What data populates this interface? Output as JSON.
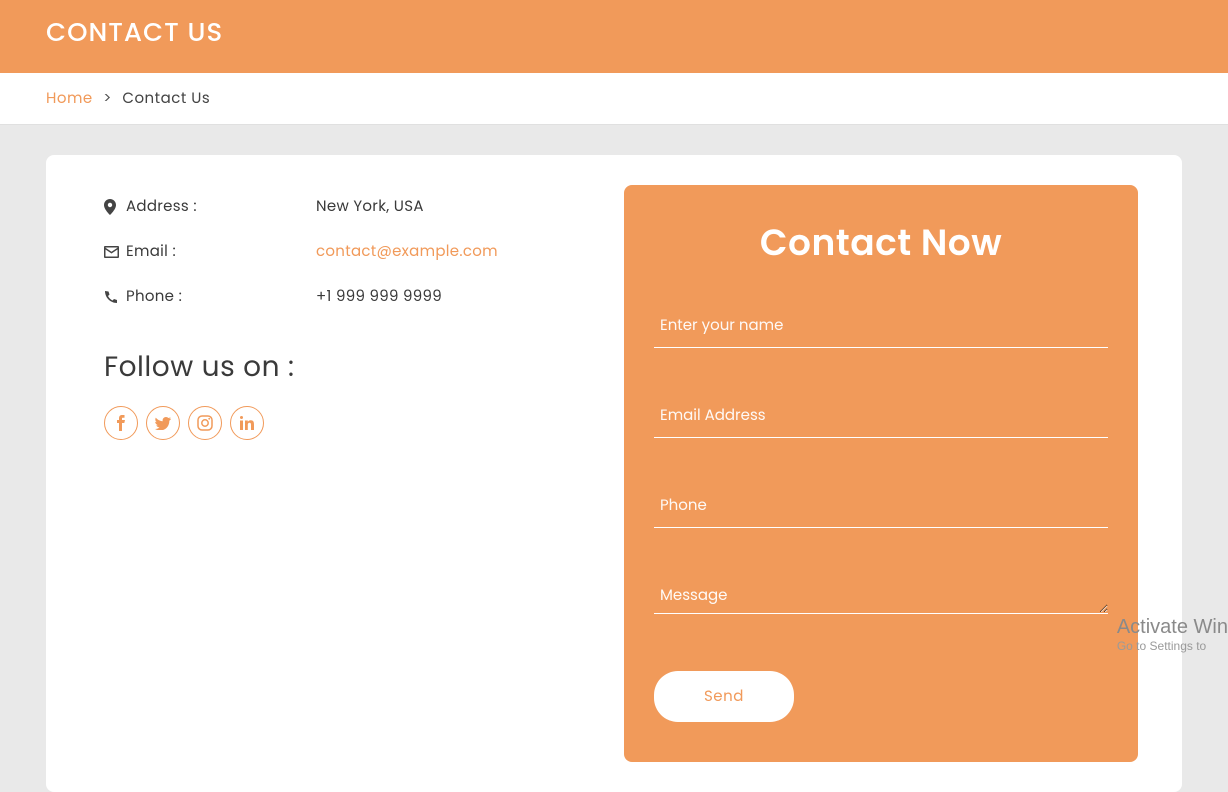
{
  "header": {
    "title": "CONTACT US"
  },
  "breadcrumb": {
    "home": "Home",
    "sep": ">",
    "current": "Contact Us"
  },
  "info": {
    "address_label": "Address :",
    "address_value": "New York, USA",
    "email_label": "Email :",
    "email_value": "contact@example.com",
    "phone_label": "Phone :",
    "phone_value": "+1 999 999 9999"
  },
  "follow": {
    "heading": "Follow us on :"
  },
  "social": {
    "facebook": "facebook-icon",
    "twitter": "twitter-icon",
    "instagram": "instagram-icon",
    "linkedin": "linkedin-icon"
  },
  "form": {
    "title": "Contact Now",
    "name_placeholder": "Enter your name",
    "email_placeholder": "Email Address",
    "phone_placeholder": "Phone",
    "message_placeholder": "Message",
    "send_label": "Send"
  },
  "watermark": {
    "line1": "Activate Win",
    "line2": "Go to Settings to"
  }
}
